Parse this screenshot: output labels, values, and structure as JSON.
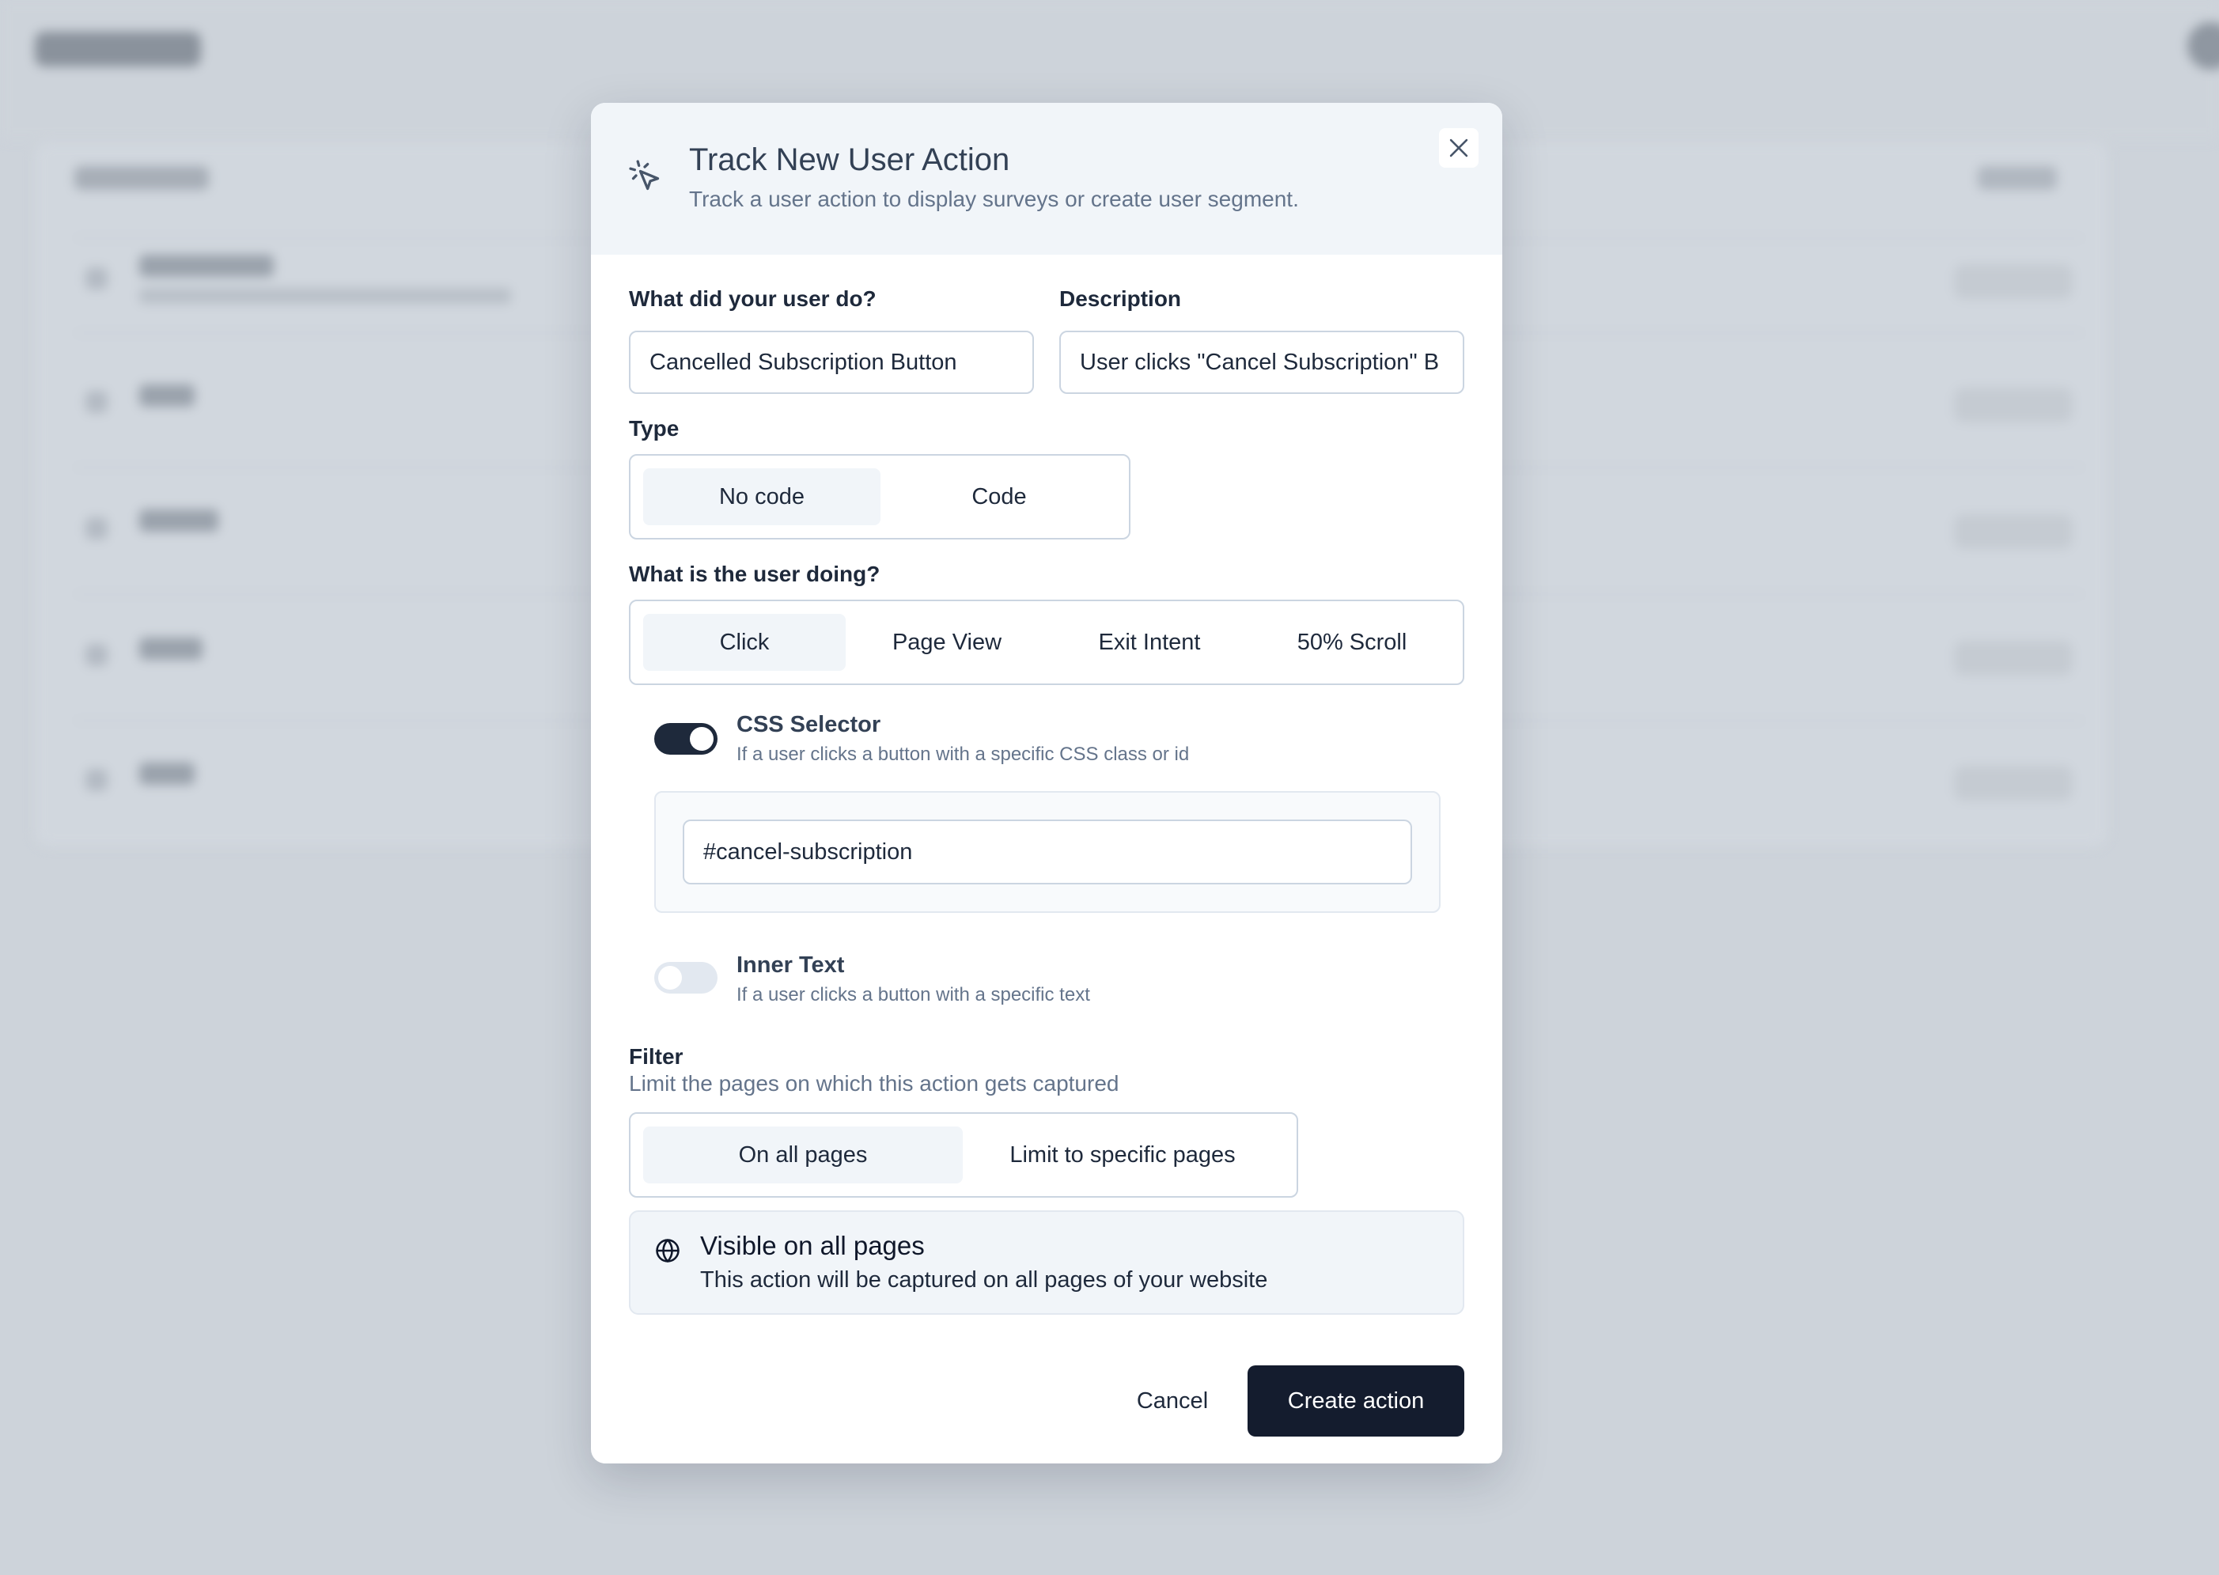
{
  "modal": {
    "title": "Track New User Action",
    "subtitle": "Track a user action to display surveys or create user segment.",
    "close_icon": "close-icon",
    "header_icon": "cursor-click-icon"
  },
  "form": {
    "user_action": {
      "label": "What did your user do?",
      "value": "Cancelled Subscription Button"
    },
    "description": {
      "label": "Description",
      "value": "User clicks \"Cancel Subscription\" B"
    },
    "type": {
      "label": "Type",
      "options": [
        "No code",
        "Code"
      ],
      "selected": "No code"
    },
    "user_doing": {
      "label": "What is the user doing?",
      "options": [
        "Click",
        "Page View",
        "Exit Intent",
        "50% Scroll"
      ],
      "selected": "Click"
    },
    "css_selector": {
      "title": "CSS Selector",
      "description": "If a user clicks a button with a specific CSS class or id",
      "enabled": true,
      "value": "#cancel-subscription"
    },
    "inner_text": {
      "title": "Inner Text",
      "description": "If a user clicks a button with a specific text",
      "enabled": false
    },
    "filter": {
      "label": "Filter",
      "hint": "Limit the pages on which this action gets captured",
      "options": [
        "On all pages",
        "Limit to specific pages"
      ],
      "selected": "On all pages"
    },
    "info": {
      "icon": "globe-icon",
      "title": "Visible on all pages",
      "description": "This action will be captured on all pages of your website"
    }
  },
  "actions": {
    "cancel_label": "Cancel",
    "create_label": "Create action"
  },
  "colors": {
    "primary": "#141c2e",
    "header_bg": "#f1f5f9",
    "backdrop": "#cdd3da"
  }
}
